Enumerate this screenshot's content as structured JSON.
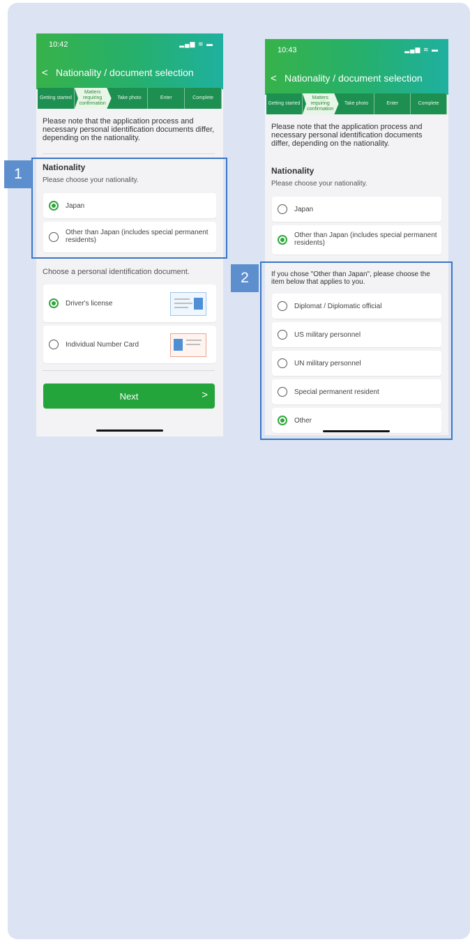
{
  "screen1": {
    "time": "10:42",
    "status_icons": "▂▄▆ ≋ ▬",
    "title": "Nationality / document selection",
    "back_glyph": "<",
    "steps": [
      "Getting started",
      "Matters requiring confirmation",
      "Take photo",
      "Enter",
      "Complete"
    ],
    "note": "Please note that the application process and necessary personal identification documents differ, depending on the nationality.",
    "nationality_title": "Nationality",
    "nationality_prompt": "Please choose your nationality.",
    "options": [
      "Japan",
      "Other than Japan (includes special permanent residents)"
    ],
    "doc_prompt": "Choose a personal identification document.",
    "doc_options": [
      "Driver's license",
      "Individual Number Card"
    ],
    "next_label": "Next",
    "next_chevron": ">"
  },
  "screen2": {
    "time": "10:43",
    "status_icons": "▂▄▆ ≋ ▬",
    "title": "Nationality / document selection",
    "back_glyph": "<",
    "steps": [
      "Getting started",
      "Matters requiring confirmation",
      "Take photo",
      "Enter",
      "Complete"
    ],
    "note": "Please note that the application process and necessary personal identification documents differ, depending on the nationality.",
    "nationality_title": "Nationality",
    "nationality_prompt": "Please choose your nationality.",
    "options": [
      "Japan",
      "Other than Japan (includes special permanent residents)"
    ],
    "other_prompt": "If you chose \"Other than Japan\", please choose the item below that applies to you.",
    "other_options": [
      "Diplomat / Diplomatic official",
      "US military personnel",
      "UN military personnel",
      "Special permanent resident",
      "Other"
    ]
  },
  "badges": [
    "1",
    "2"
  ],
  "colors": {
    "brand_green": "#23a53b",
    "highlight_blue": "#3a74c6",
    "badge_blue": "#5d8fce",
    "background": "#dce4f3"
  }
}
